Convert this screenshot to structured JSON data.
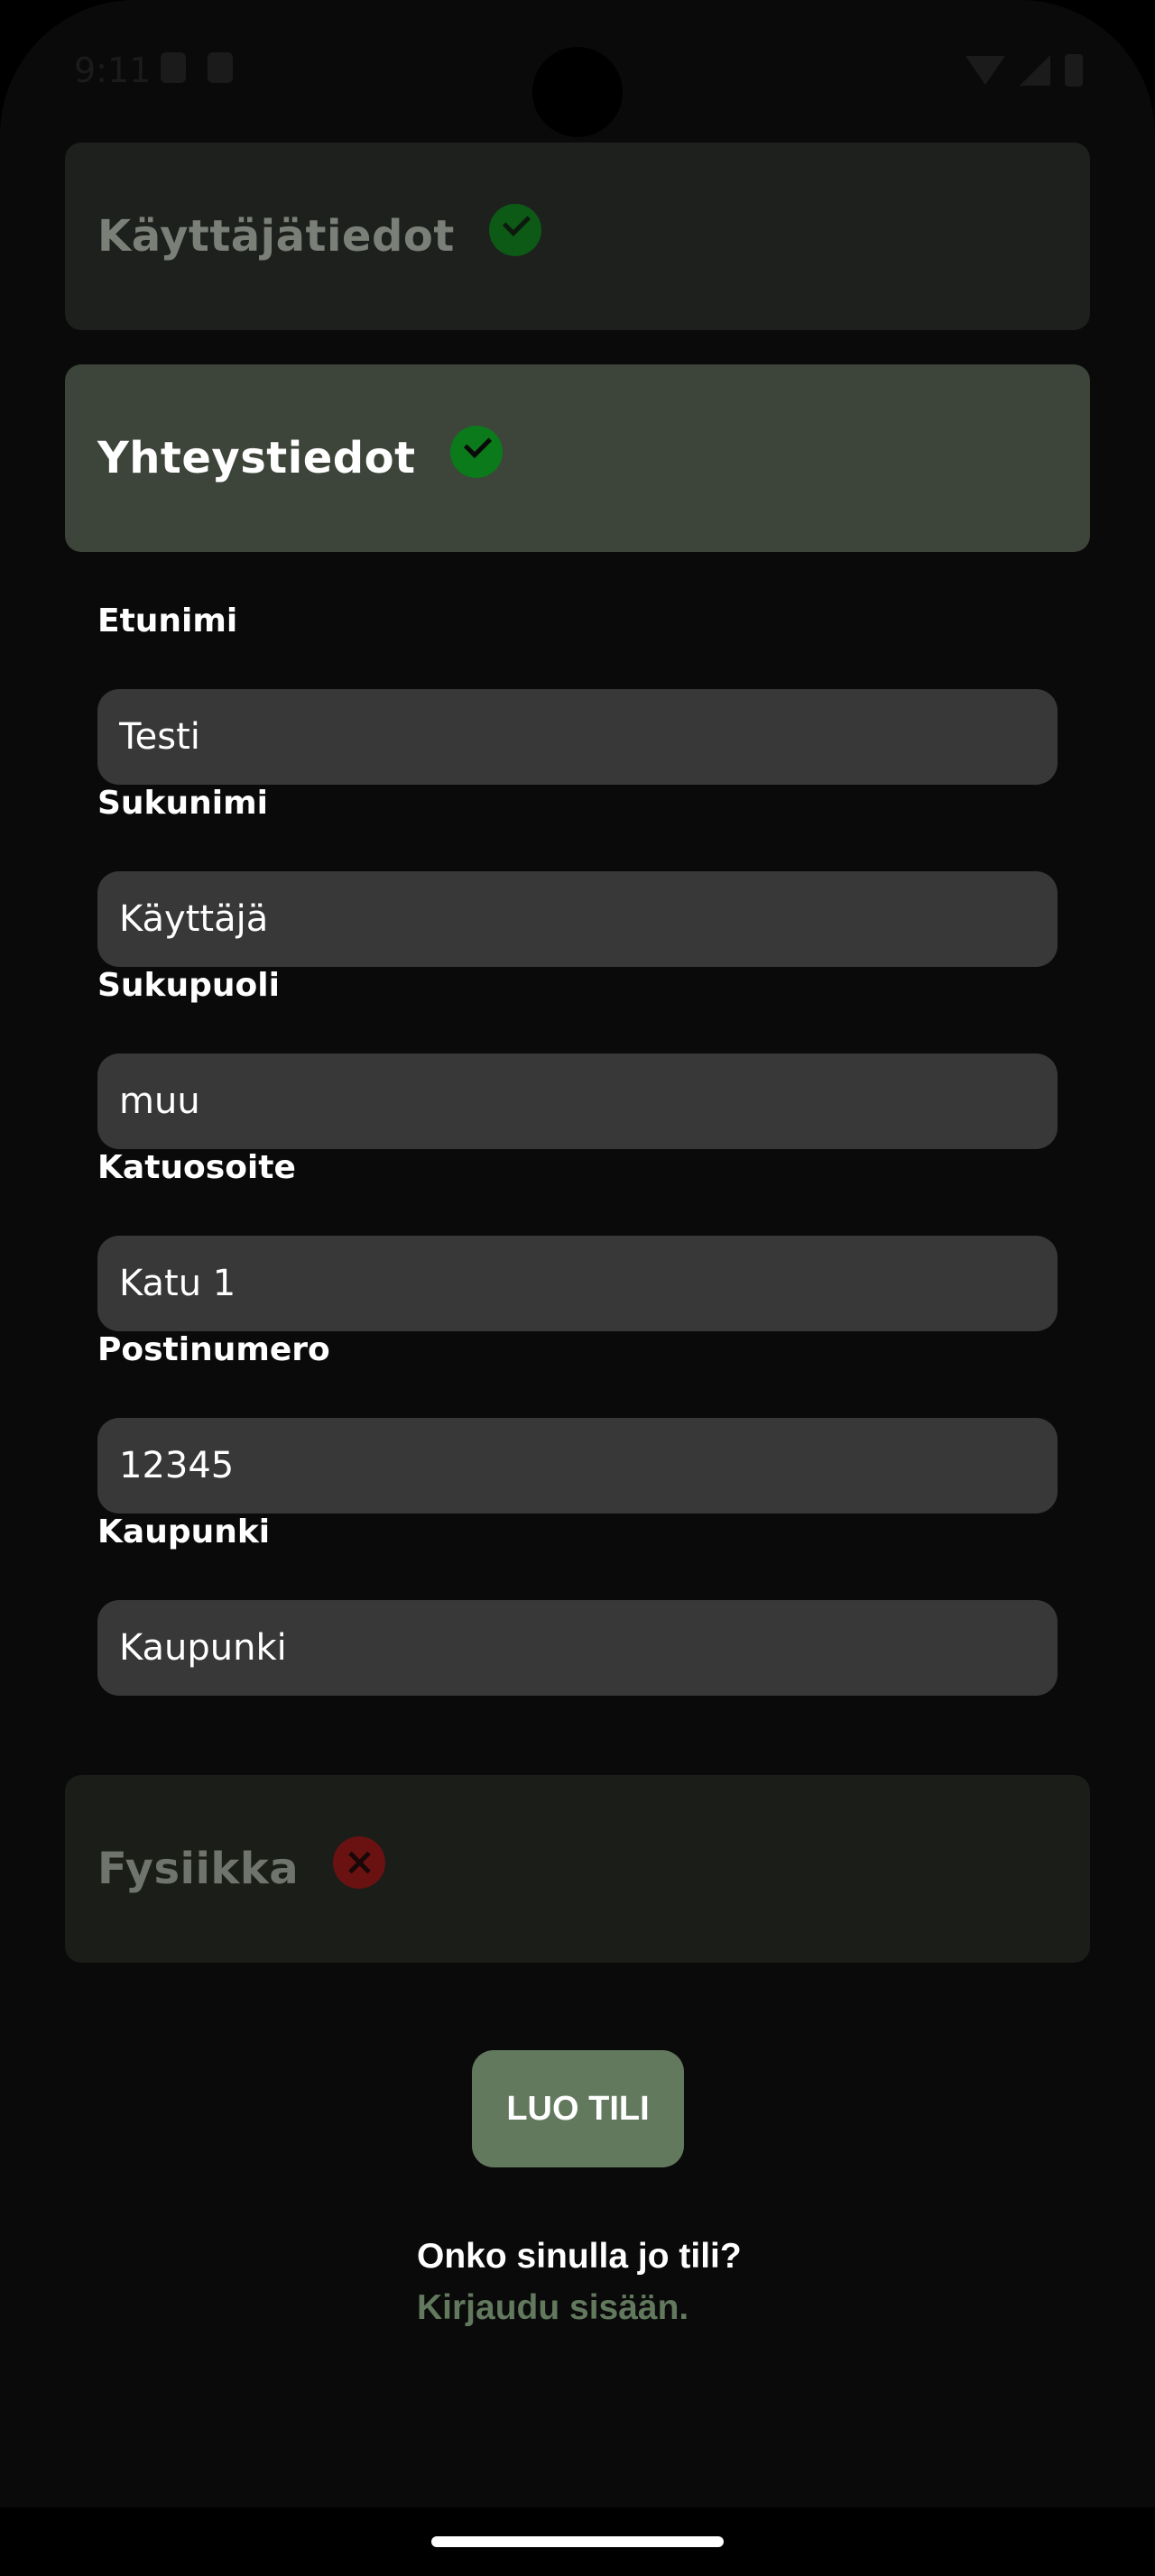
{
  "status_bar": {
    "time": "9:11"
  },
  "sections": {
    "user_info": {
      "title": "Käyttäjätiedot",
      "status": "complete",
      "icon": "check-icon"
    },
    "contact_info": {
      "title": "Yhteystiedot",
      "status": "complete",
      "icon": "check-icon"
    },
    "physical": {
      "title": "Fysiikka",
      "status": "incomplete",
      "icon": "cross-icon"
    }
  },
  "form": {
    "first_name": {
      "label": "Etunimi",
      "value": "Testi"
    },
    "last_name": {
      "label": "Sukunimi",
      "value": "Käyttäjä"
    },
    "gender": {
      "label": "Sukupuoli",
      "value": "muu"
    },
    "street": {
      "label": "Katuosoite",
      "value": "Katu 1"
    },
    "postal_code": {
      "label": "Postinumero",
      "value": "12345"
    },
    "city": {
      "label": "Kaupunki",
      "value": "Kaupunki"
    }
  },
  "actions": {
    "create_account": "LUO TILI",
    "login_prompt": "Onko sinulla jo tili?",
    "login_link": "Kirjaudu sisään."
  },
  "colors": {
    "accent": "#62795e",
    "success": "#0a7a1a",
    "error": "#6a1212",
    "input_bg": "#383838"
  }
}
